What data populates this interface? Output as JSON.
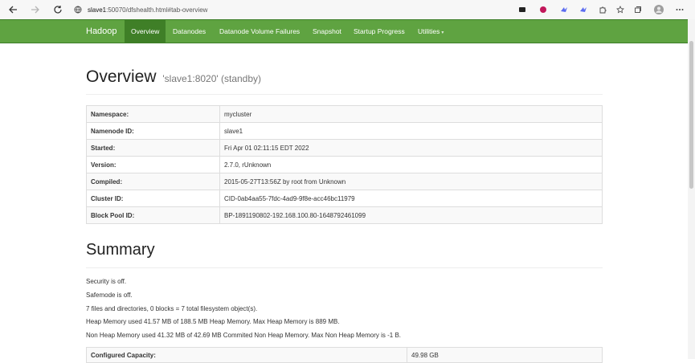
{
  "browser": {
    "url_host": "slave1",
    "url_rest": ":50070/dfshealth.html#tab-overview"
  },
  "navbar": {
    "brand": "Hadoop",
    "items": [
      {
        "label": "Overview",
        "active": true
      },
      {
        "label": "Datanodes"
      },
      {
        "label": "Datanode Volume Failures"
      },
      {
        "label": "Snapshot"
      },
      {
        "label": "Startup Progress"
      },
      {
        "label": "Utilities"
      }
    ]
  },
  "overview": {
    "title": "Overview",
    "subtitle": "'slave1:8020' (standby)",
    "rows": [
      {
        "key": "Namespace:",
        "value": "mycluster"
      },
      {
        "key": "Namenode ID:",
        "value": "slave1"
      },
      {
        "key": "Started:",
        "value": "Fri Apr 01 02:11:15 EDT 2022"
      },
      {
        "key": "Version:",
        "value": "2.7.0, rUnknown"
      },
      {
        "key": "Compiled:",
        "value": "2015-05-27T13:56Z by root from Unknown"
      },
      {
        "key": "Cluster ID:",
        "value": "CID-0ab4aa55-7fdc-4ad9-9f8e-acc46bc11979"
      },
      {
        "key": "Block Pool ID:",
        "value": "BP-1891190802-192.168.100.80-1648792461099"
      }
    ]
  },
  "summary": {
    "title": "Summary",
    "lines": [
      "Security is off.",
      "Safemode is off.",
      "7 files and directories, 0 blocks = 7 total filesystem object(s).",
      "Heap Memory used 41.57 MB of 188.5 MB Heap Memory. Max Heap Memory is 889 MB.",
      "Non Heap Memory used 41.32 MB of 42.69 MB Commited Non Heap Memory. Max Non Heap Memory is -1 B."
    ],
    "capacity_label": "Configured Capacity:",
    "capacity_value": "49.98 GB"
  },
  "colors": {
    "navbar": "#5fa341",
    "navbar_active": "#3f7f27"
  }
}
